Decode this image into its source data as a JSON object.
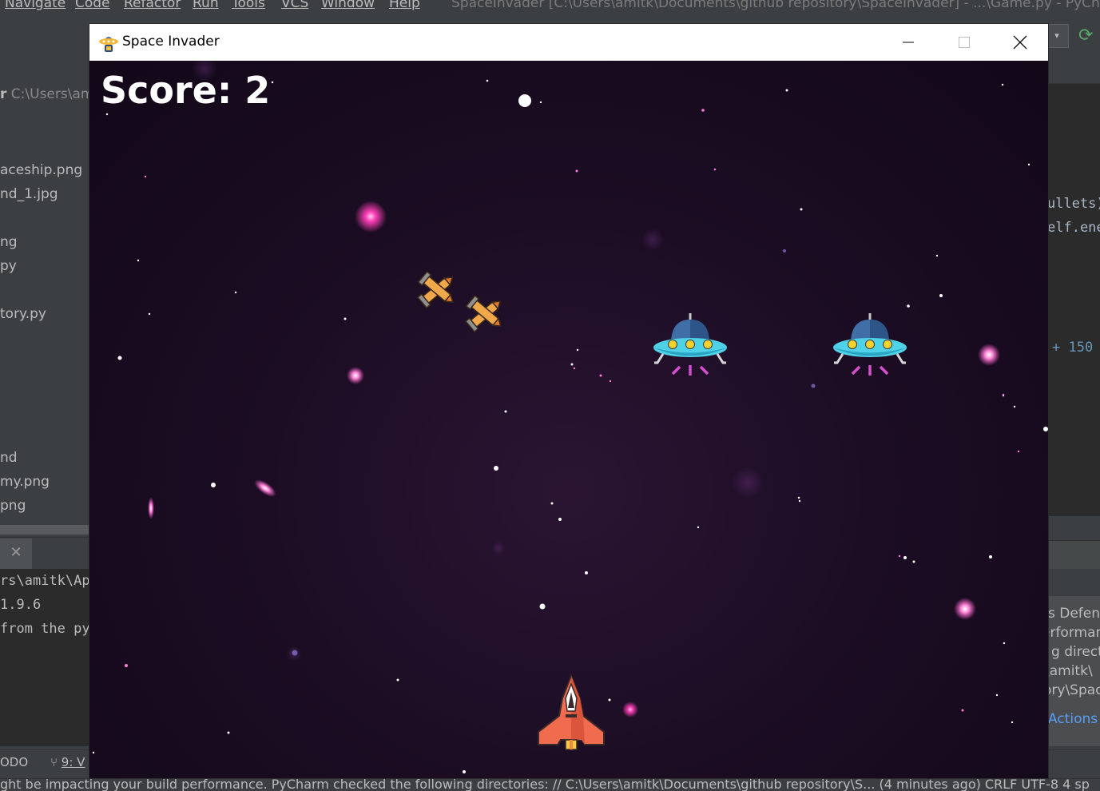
{
  "ide": {
    "menu": [
      "Navigate",
      "Code",
      "Refactor",
      "Run",
      "Tools",
      "VCS",
      "Window",
      "Help"
    ],
    "window_title": "SpaceInvader [C:\\Users\\amitk\\Documents\\github repository\\SpaceInvader] - ...\\Game.py - PyCharm",
    "project_header_prefix": "r",
    "project_header_path": "C:\\Users\\am",
    "project_items": [
      "aceship.png",
      "nd_1.jpg",
      "ng",
      "py",
      "tory.py",
      "nd",
      "my.png",
      "png"
    ],
    "console_lines": [
      "rs\\amitk\\App",
      " 1.9.6",
      "from the pyg"
    ],
    "code_lines": [
      {
        "text": "ullets)",
        "color": "#a9b7c6"
      },
      {
        "text": "elf.ene",
        "color": "#a9b7c6",
        "prefix_color": "#cc7832"
      },
      {
        "text": "+ 150",
        "color": "#6897bb"
      }
    ],
    "notification_lines": [
      "s Defen",
      "erforman",
      "g direct",
      "\\amitk\\",
      "ory\\Spac"
    ],
    "notification_action": "Actions ▾",
    "bottom_tabs": {
      "todo": "ODO",
      "vcs": "9: V"
    },
    "status_text": "ght be impacting your build performance. PyCharm checked the following directories: // C:\\Users\\amitk\\Documents\\github repository\\S... (4 minutes ago)    CRLF    UTF-8    4 sp"
  },
  "game_window": {
    "title": "Space Invader",
    "icon": "ufo-icon",
    "controls": [
      "minimize",
      "maximize",
      "close"
    ]
  },
  "game": {
    "score_text": "Score: 2",
    "sprites": {
      "player": "red-spaceship",
      "enemies": [
        "ufo",
        "ufo"
      ],
      "bullets": [
        "missile",
        "missile"
      ]
    }
  }
}
